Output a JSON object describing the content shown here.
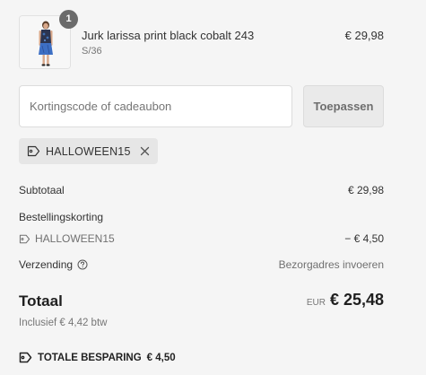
{
  "cart": {
    "item": {
      "quantity": "1",
      "name": "Jurk larissa print black cobalt 243",
      "variant": "S/36",
      "price": "€ 29,98",
      "thumbnail_icon": "dress-photo"
    }
  },
  "discount": {
    "placeholder": "Kortingscode of cadeaubon",
    "value": "",
    "apply_label": "Toepassen",
    "applied_code": "HALLOWEEN15",
    "tag_icon": "tag-icon",
    "remove_icon": "close-icon"
  },
  "summary": {
    "subtotal_label": "Subtotaal",
    "subtotal_value": "€ 29,98",
    "order_discount_label": "Bestellingskorting",
    "discount_code": "HALLOWEEN15",
    "discount_value": "− € 4,50",
    "shipping_label": "Verzending",
    "shipping_icon": "help-circle-icon",
    "shipping_value": "Bezorgadres invoeren",
    "total_label": "Totaal",
    "total_currency": "EUR",
    "total_value": "€ 25,48",
    "tax_note": "Inclusief € 4,42 btw",
    "savings_label": "TOTALE BESPARING",
    "savings_value": "€ 4,50"
  },
  "colors": {
    "background": "#f5f5f5",
    "text": "#333333",
    "muted": "#767676",
    "chip": "#e6e6e6",
    "badge": "#6b6b6b"
  }
}
